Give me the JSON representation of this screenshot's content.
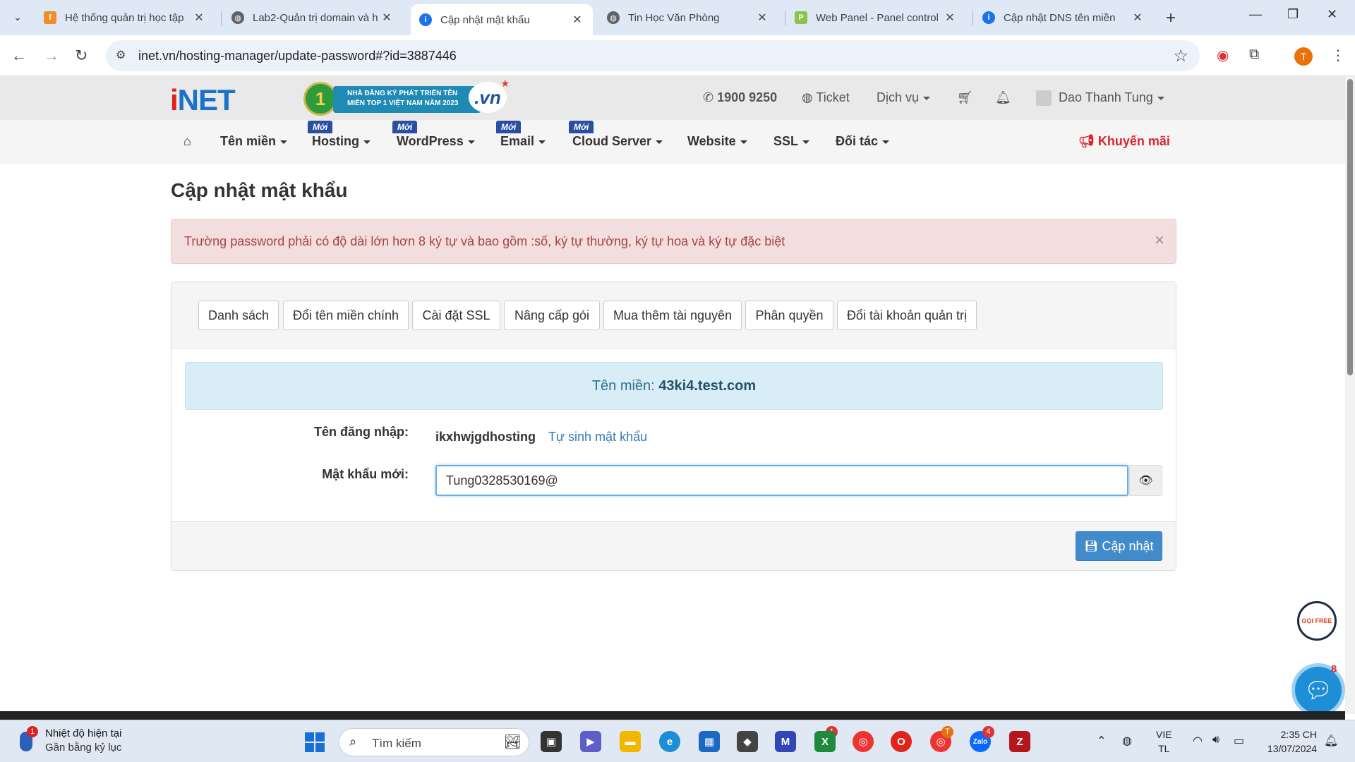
{
  "browser": {
    "tabs": [
      {
        "label": "Hệ thống quản trị học tập",
        "icon": "fpt-icon",
        "active": false
      },
      {
        "label": "Lab2-Quản trị domain và h",
        "icon": "globe-icon",
        "active": false
      },
      {
        "label": "Cập nhật mật khẩu",
        "icon": "info-icon",
        "active": true
      },
      {
        "label": "Tin Học Văn Phòng",
        "icon": "globe-icon",
        "active": false
      },
      {
        "label": "Web Panel - Panel control",
        "icon": "panel-logo-icon",
        "active": false
      },
      {
        "label": "Cập nhật DNS tên miền",
        "icon": "info-icon",
        "active": false
      }
    ],
    "url": "inet.vn/hosting-manager/update-password#?id=3887446",
    "profile_initial": "T"
  },
  "site": {
    "logo_text": "iNET",
    "award": {
      "number": "1",
      "text_line1": "NHÀ ĐĂNG KÝ PHÁT TRIỂN TÊN",
      "text_line2": "MIỀN TOP 1 VIỆT NAM NĂM 2023",
      "suffix": ".vn"
    },
    "phone": "1900 9250",
    "ticket": "Ticket",
    "services": "Dịch vụ",
    "user_name": "Dao Thanh Tung",
    "nav": [
      {
        "label": "Tên miền",
        "badge": ""
      },
      {
        "label": "Hosting",
        "badge": "Mới"
      },
      {
        "label": "WordPress",
        "badge": "Mới"
      },
      {
        "label": "Email",
        "badge": "Mới"
      },
      {
        "label": "Cloud Server",
        "badge": "Mới"
      },
      {
        "label": "Website",
        "badge": ""
      },
      {
        "label": "SSL",
        "badge": ""
      },
      {
        "label": "Đối tác",
        "badge": ""
      }
    ],
    "promo": "Khuyến mãi"
  },
  "page": {
    "title": "Cập nhật mật khẩu",
    "alert": "Trường password phải có độ dài lớn hơn 8 ký tự và bao gồm :số, ký tự thường, ký tự hoa và ký tự đặc biệt",
    "tabs": [
      "Danh sách",
      "Đổi tên miền chính",
      "Cài đặt SSL",
      "Nâng cấp gói",
      "Mua thêm tài nguyên",
      "Phân quyền",
      "Đổi tài khoản quản trị"
    ],
    "domain_label": "Tên miền:",
    "domain_value": "43ki4.test.com",
    "username_label": "Tên đăng nhập:",
    "username_value": "ikxhwjgdhosting",
    "generate_link": "Tự sinh mật khẩu",
    "password_label": "Mật khẩu mới:",
    "password_value": "Tung0328530169@",
    "submit_label": "Cập nhật"
  },
  "widgets": {
    "support_text": "GỌI FREE",
    "chat_badge": "8"
  },
  "taskbar": {
    "weather_title": "Nhiệt độ hiện tại",
    "weather_sub": "Gần bằng kỷ lục",
    "weather_badge": "1",
    "search_placeholder": "Tìm kiếm",
    "lang_line1": "VIE",
    "lang_line2": "TL",
    "time": "2:35 CH",
    "date": "13/07/2024",
    "badges": {
      "teams": "1",
      "chrome_profile": "T",
      "zalo": "4"
    }
  },
  "colors": {
    "brand_blue": "#1a73c8",
    "alert_bg": "#f2dede",
    "alert_text": "#a94442",
    "info_bg": "#d9edf7",
    "primary_button": "#428bca",
    "promo_red": "#d9262c"
  }
}
